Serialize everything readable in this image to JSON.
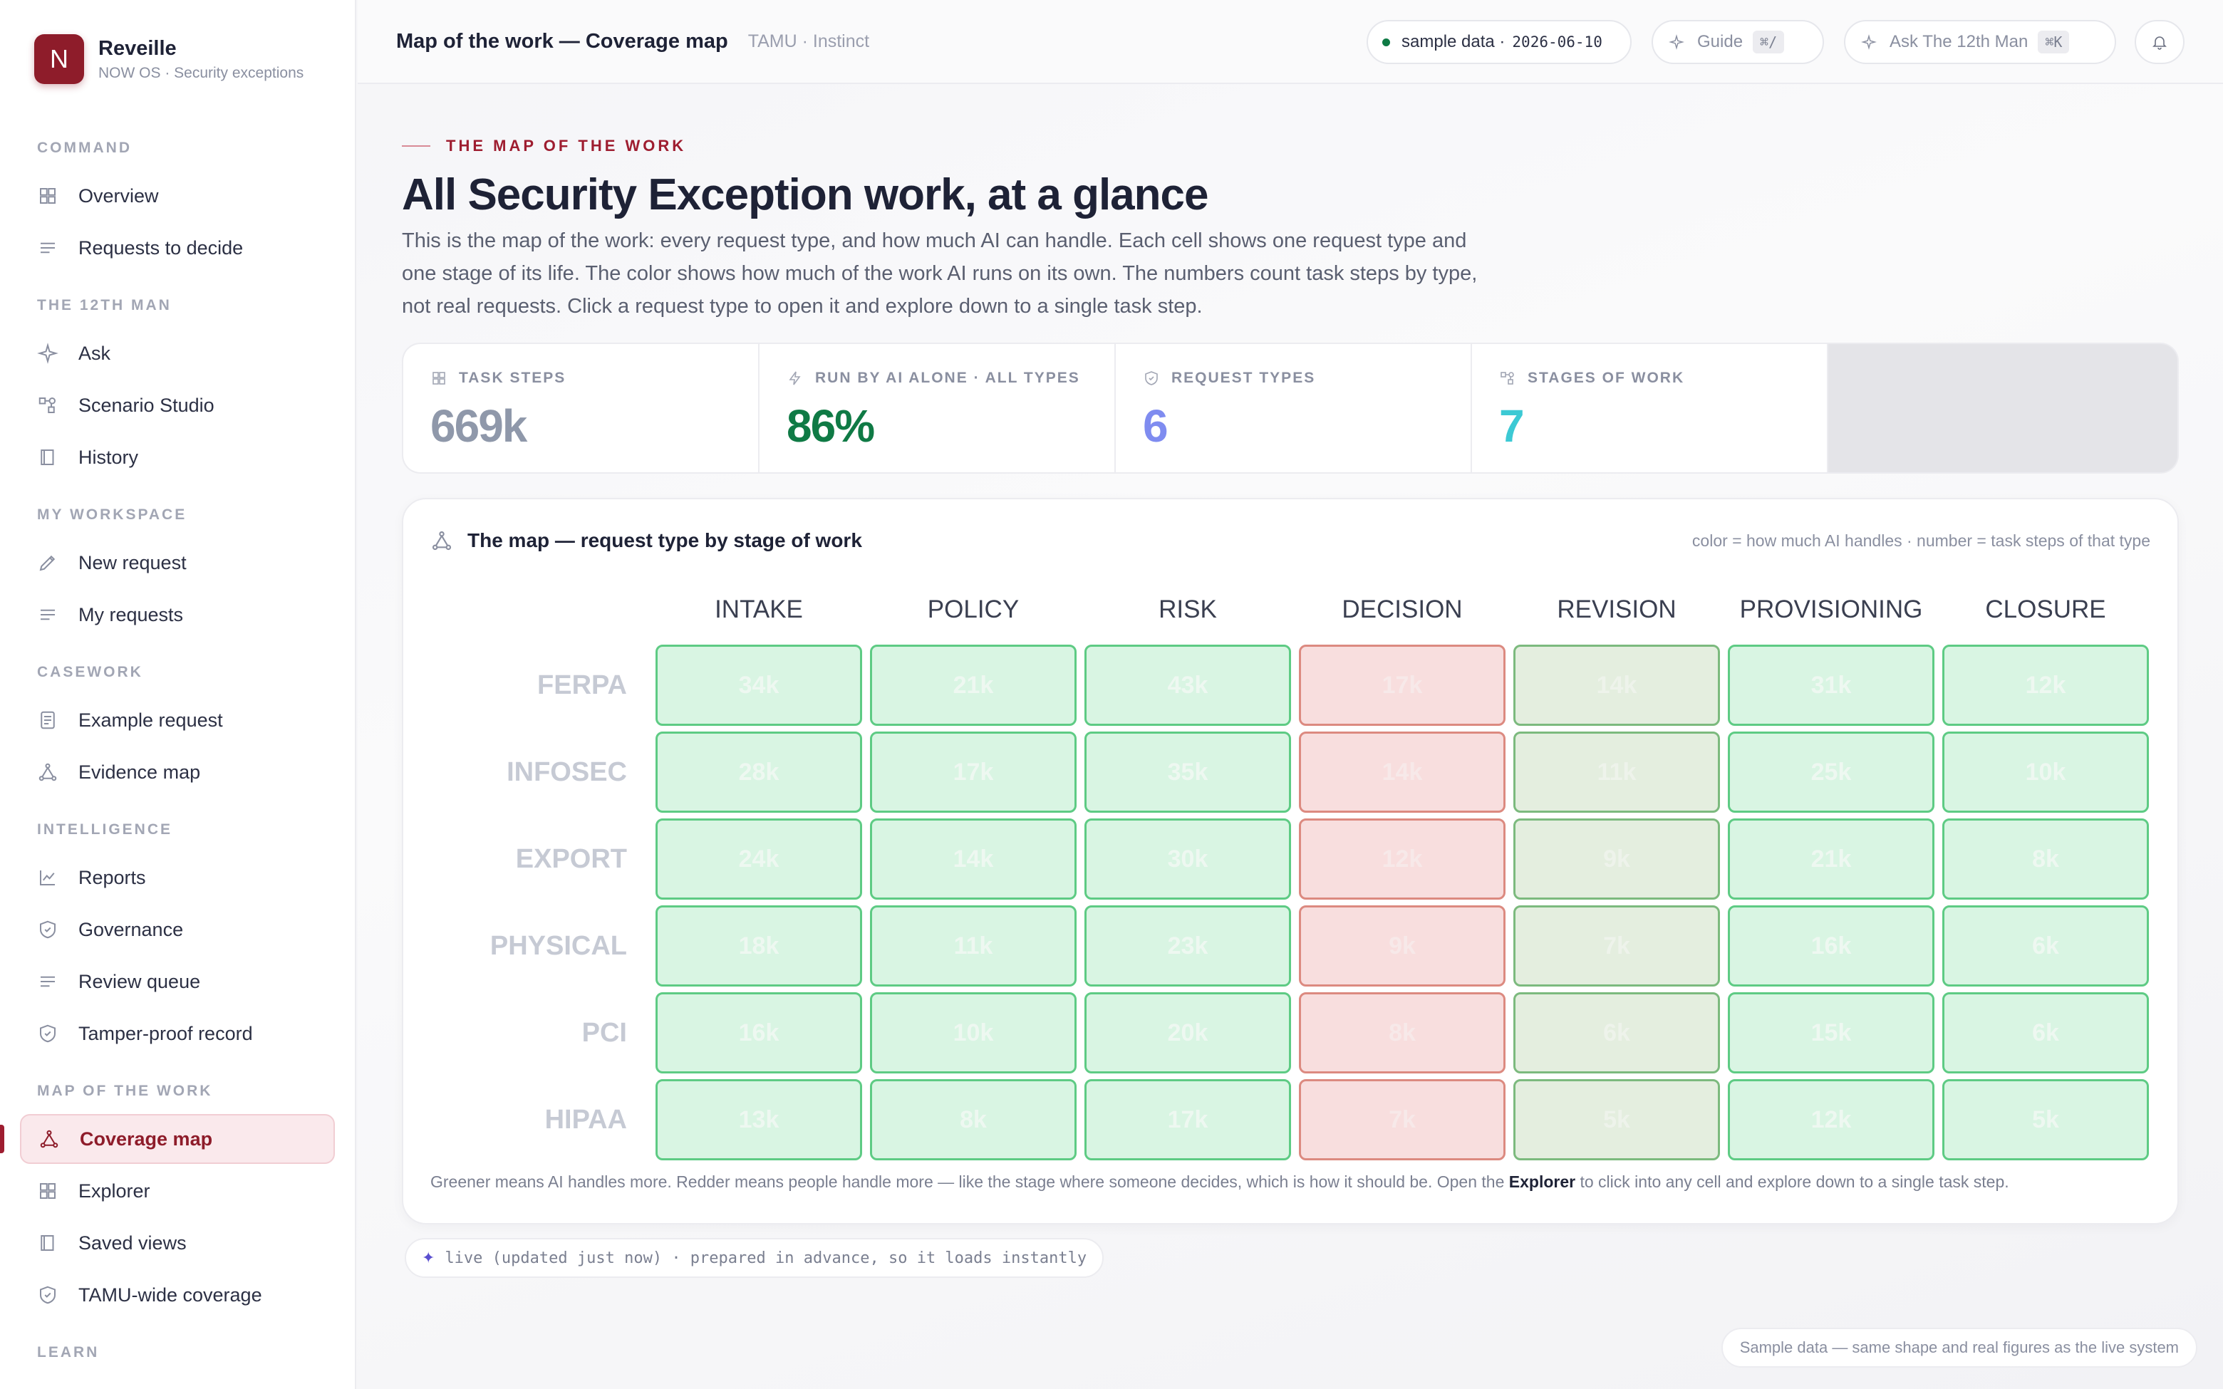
{
  "brand": {
    "logo": "N",
    "name": "Reveille",
    "subtitle": "NOW OS · Security exceptions"
  },
  "sidebar": {
    "sections": [
      {
        "title": "COMMAND",
        "items": [
          {
            "label": "Overview",
            "icon": "grid-icon"
          },
          {
            "label": "Requests to decide",
            "icon": "list-icon"
          }
        ]
      },
      {
        "title": "THE 12TH MAN",
        "items": [
          {
            "label": "Ask",
            "icon": "sparkle-icon"
          },
          {
            "label": "Scenario Studio",
            "icon": "nodes-icon"
          },
          {
            "label": "History",
            "icon": "book-icon"
          }
        ]
      },
      {
        "title": "MY WORKSPACE",
        "items": [
          {
            "label": "New request",
            "icon": "pencil-icon"
          },
          {
            "label": "My requests",
            "icon": "list-icon"
          }
        ]
      },
      {
        "title": "CASEWORK",
        "items": [
          {
            "label": "Example request",
            "icon": "document-icon"
          },
          {
            "label": "Evidence map",
            "icon": "network-icon"
          }
        ]
      },
      {
        "title": "INTELLIGENCE",
        "items": [
          {
            "label": "Reports",
            "icon": "chart-icon"
          },
          {
            "label": "Governance",
            "icon": "shield-icon"
          },
          {
            "label": "Review queue",
            "icon": "list-icon"
          },
          {
            "label": "Tamper-proof record",
            "icon": "shield-icon"
          }
        ]
      },
      {
        "title": "MAP OF THE WORK",
        "items": [
          {
            "label": "Coverage map",
            "icon": "network-icon",
            "active": true
          },
          {
            "label": "Explorer",
            "icon": "grid-icon"
          },
          {
            "label": "Saved views",
            "icon": "book-icon"
          },
          {
            "label": "TAMU-wide coverage",
            "icon": "shield-icon"
          }
        ]
      },
      {
        "title": "LEARN",
        "items": []
      }
    ]
  },
  "topbar": {
    "title": "Map of the work — Coverage map",
    "subtitle": "TAMU · Instinct",
    "sample_label": "sample data ·",
    "sample_date": "2026-06-10",
    "guide_label": "Guide",
    "guide_kbd": "⌘/",
    "ask_label": "Ask The 12th Man",
    "ask_kbd": "⌘K"
  },
  "page": {
    "eyebrow": "THE MAP OF THE WORK",
    "title": "All Security Exception work, at a glance",
    "intro": "This is the map of the work: every request type, and how much AI can handle. Each cell shows one request type and one stage of its life. The color shows how much of the work AI runs on its own. The numbers count task steps by type, not real requests. Click a request type to open it and explore down to a single task step."
  },
  "stats": [
    {
      "label": "TASK STEPS",
      "value": "669k",
      "color": "#8f98aa",
      "icon": "grid-icon"
    },
    {
      "label": "RUN BY AI ALONE · ALL TYPES",
      "value": "86%",
      "color": "#0f7a45",
      "icon": "bolt-icon"
    },
    {
      "label": "REQUEST TYPES",
      "value": "6",
      "color": "#7f8cf0",
      "icon": "shield-icon"
    },
    {
      "label": "STAGES OF WORK",
      "value": "7",
      "color": "#3cc9d4",
      "icon": "nodes-icon"
    }
  ],
  "map": {
    "title": "The map — request type by stage of work",
    "legend": "color = how much AI handles · number = task steps of that type",
    "stages": [
      "INTAKE",
      "POLICY",
      "RISK",
      "DECISION",
      "REVISION",
      "PROVISIONING",
      "CLOSURE"
    ],
    "stage_tone": [
      "green",
      "green",
      "green",
      "red",
      "mid",
      "green",
      "green"
    ],
    "types": [
      "FERPA",
      "INFOSEC",
      "EXPORT",
      "PHYSICAL",
      "PCI",
      "HIPAA"
    ],
    "values": [
      [
        "34k",
        "21k",
        "43k",
        "17k",
        "14k",
        "31k",
        "12k"
      ],
      [
        "28k",
        "17k",
        "35k",
        "14k",
        "11k",
        "25k",
        "10k"
      ],
      [
        "24k",
        "14k",
        "30k",
        "12k",
        "9k",
        "21k",
        "8k"
      ],
      [
        "18k",
        "11k",
        "23k",
        "9k",
        "7k",
        "16k",
        "6k"
      ],
      [
        "16k",
        "10k",
        "20k",
        "8k",
        "6k",
        "15k",
        "6k"
      ],
      [
        "13k",
        "8k",
        "17k",
        "7k",
        "5k",
        "12k",
        "5k"
      ]
    ],
    "footer_pre": "Greener means AI handles more. Redder means people handle more — like the stage where someone decides, which is how it should be. Open the ",
    "footer_link": "Explorer",
    "footer_post": " to click into any cell and explore down to a single task step."
  },
  "live_note": "live (updated just now) · prepared in advance, so it loads instantly",
  "sample_note": "Sample data — same shape and real figures as the live system"
}
